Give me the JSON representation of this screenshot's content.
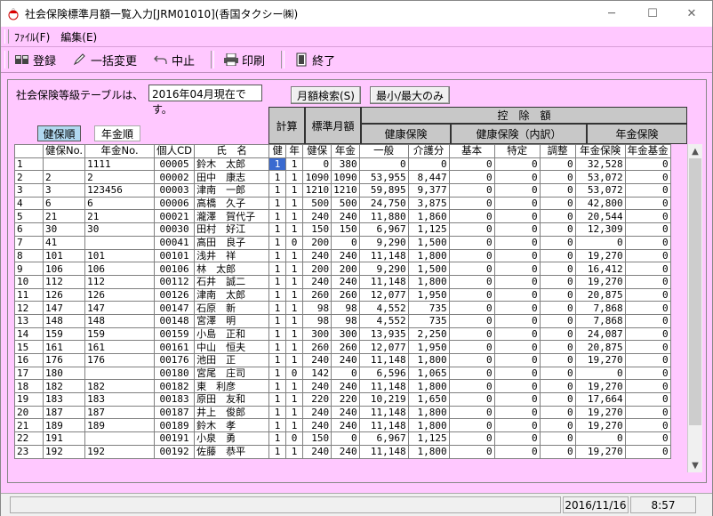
{
  "window": {
    "title": "社会保険標準月額一覧入力[JRM01010](香国タクシー㈱)"
  },
  "menu": [
    "ﾌｧｲﾙ(F)",
    "編集(E)"
  ],
  "toolbar": {
    "register": "登録",
    "bulk_change": "一括変更",
    "cancel": "中止",
    "print": "印刷",
    "exit": "終了"
  },
  "info": {
    "prefix": "社会保険等級テーブルは、",
    "date": "2016年04月現在です。"
  },
  "buttons": {
    "month_search": "月額検索(S)",
    "minmax": "最小/最大のみ"
  },
  "sort": {
    "health": "健保順",
    "pension": "年金順"
  },
  "headers": {
    "keisan": "計算",
    "standard_monthly": "標準月額",
    "deduction": "控　除　額",
    "health_ins": "健康保険",
    "health_ins_detail": "健康保険（内訳）",
    "pension_ins": "年金保険"
  },
  "columns": [
    "健保No.",
    "年金No.",
    "個人CD",
    "氏　名",
    "健",
    "年",
    "健保",
    "年金",
    "一般",
    "介護分",
    "基本",
    "特定",
    "調整",
    "年金保険",
    "年金基金"
  ],
  "rows": [
    [
      "1",
      "",
      "1111",
      "00005",
      "鈴木　太郎",
      "1",
      "1",
      "0",
      "380",
      "0",
      "0",
      "0",
      "0",
      "0",
      "32,528",
      "0"
    ],
    [
      "2",
      "2",
      "2",
      "00002",
      "田中　康志",
      "1",
      "1",
      "1090",
      "1090",
      "53,955",
      "8,447",
      "0",
      "0",
      "0",
      "53,072",
      "0"
    ],
    [
      "3",
      "3",
      "123456",
      "00003",
      "津南　一郎",
      "1",
      "1",
      "1210",
      "1210",
      "59,895",
      "9,377",
      "0",
      "0",
      "0",
      "53,072",
      "0"
    ],
    [
      "4",
      "6",
      "6",
      "00006",
      "高橋　久子",
      "1",
      "1",
      "500",
      "500",
      "24,750",
      "3,875",
      "0",
      "0",
      "0",
      "42,800",
      "0"
    ],
    [
      "5",
      "21",
      "21",
      "00021",
      "瀧澤　賀代子",
      "1",
      "1",
      "240",
      "240",
      "11,880",
      "1,860",
      "0",
      "0",
      "0",
      "20,544",
      "0"
    ],
    [
      "6",
      "30",
      "30",
      "00030",
      "田村　好江",
      "1",
      "1",
      "150",
      "150",
      "6,967",
      "1,125",
      "0",
      "0",
      "0",
      "12,309",
      "0"
    ],
    [
      "7",
      "41",
      "",
      "00041",
      "高田　良子",
      "1",
      "0",
      "200",
      "0",
      "9,290",
      "1,500",
      "0",
      "0",
      "0",
      "0",
      "0"
    ],
    [
      "8",
      "101",
      "101",
      "00101",
      "浅井　祥",
      "1",
      "1",
      "240",
      "240",
      "11,148",
      "1,800",
      "0",
      "0",
      "0",
      "19,270",
      "0"
    ],
    [
      "9",
      "106",
      "106",
      "00106",
      "林　太郎",
      "1",
      "1",
      "200",
      "200",
      "9,290",
      "1,500",
      "0",
      "0",
      "0",
      "16,412",
      "0"
    ],
    [
      "10",
      "112",
      "112",
      "00112",
      "石井　誠二",
      "1",
      "1",
      "240",
      "240",
      "11,148",
      "1,800",
      "0",
      "0",
      "0",
      "19,270",
      "0"
    ],
    [
      "11",
      "126",
      "126",
      "00126",
      "津南　太郎",
      "1",
      "1",
      "260",
      "260",
      "12,077",
      "1,950",
      "0",
      "0",
      "0",
      "20,875",
      "0"
    ],
    [
      "12",
      "147",
      "147",
      "00147",
      "石原　新",
      "1",
      "1",
      "98",
      "98",
      "4,552",
      "735",
      "0",
      "0",
      "0",
      "7,868",
      "0"
    ],
    [
      "13",
      "148",
      "148",
      "00148",
      "宮澤　明",
      "1",
      "1",
      "98",
      "98",
      "4,552",
      "735",
      "0",
      "0",
      "0",
      "7,868",
      "0"
    ],
    [
      "14",
      "159",
      "159",
      "00159",
      "小島　正和",
      "1",
      "1",
      "300",
      "300",
      "13,935",
      "2,250",
      "0",
      "0",
      "0",
      "24,087",
      "0"
    ],
    [
      "15",
      "161",
      "161",
      "00161",
      "中山　恒夫",
      "1",
      "1",
      "260",
      "260",
      "12,077",
      "1,950",
      "0",
      "0",
      "0",
      "20,875",
      "0"
    ],
    [
      "16",
      "176",
      "176",
      "00176",
      "池田　正",
      "1",
      "1",
      "240",
      "240",
      "11,148",
      "1,800",
      "0",
      "0",
      "0",
      "19,270",
      "0"
    ],
    [
      "17",
      "180",
      "",
      "00180",
      "宮尾　庄司",
      "1",
      "0",
      "142",
      "0",
      "6,596",
      "1,065",
      "0",
      "0",
      "0",
      "0",
      "0"
    ],
    [
      "18",
      "182",
      "182",
      "00182",
      "東　利彦",
      "1",
      "1",
      "240",
      "240",
      "11,148",
      "1,800",
      "0",
      "0",
      "0",
      "19,270",
      "0"
    ],
    [
      "19",
      "183",
      "183",
      "00183",
      "原田　友和",
      "1",
      "1",
      "220",
      "220",
      "10,219",
      "1,650",
      "0",
      "0",
      "0",
      "17,664",
      "0"
    ],
    [
      "20",
      "187",
      "187",
      "00187",
      "井上　俊郎",
      "1",
      "1",
      "240",
      "240",
      "11,148",
      "1,800",
      "0",
      "0",
      "0",
      "19,270",
      "0"
    ],
    [
      "21",
      "189",
      "189",
      "00189",
      "鈴木　孝",
      "1",
      "1",
      "240",
      "240",
      "11,148",
      "1,800",
      "0",
      "0",
      "0",
      "19,270",
      "0"
    ],
    [
      "22",
      "191",
      "",
      "00191",
      "小泉　勇",
      "1",
      "0",
      "150",
      "0",
      "6,967",
      "1,125",
      "0",
      "0",
      "0",
      "0",
      "0"
    ],
    [
      "23",
      "192",
      "192",
      "00192",
      "佐藤　恭平",
      "1",
      "1",
      "240",
      "240",
      "11,148",
      "1,800",
      "0",
      "0",
      "0",
      "19,270",
      "0"
    ]
  ],
  "status": {
    "date": "2016/11/16",
    "time": "8:57"
  }
}
